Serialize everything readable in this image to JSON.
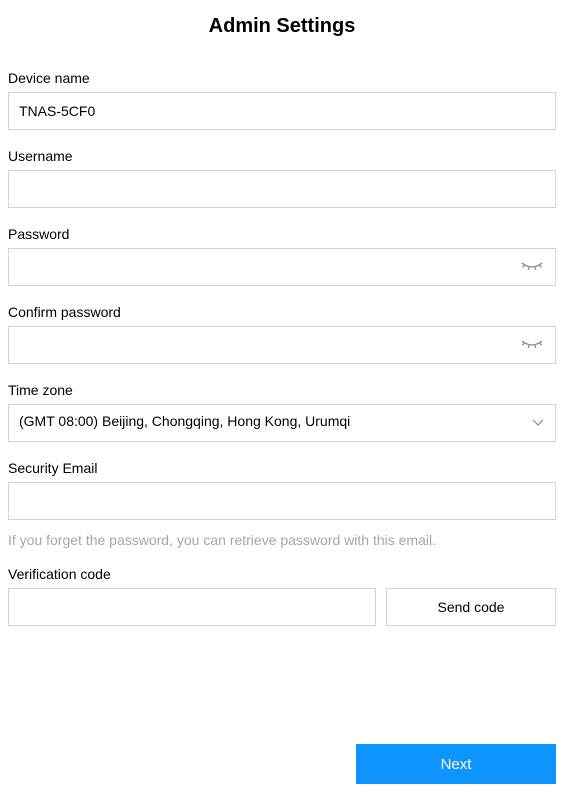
{
  "title": "Admin Settings",
  "fields": {
    "device_name": {
      "label": "Device name",
      "value": "TNAS-5CF0"
    },
    "username": {
      "label": "Username",
      "value": ""
    },
    "password": {
      "label": "Password",
      "value": ""
    },
    "confirm_password": {
      "label": "Confirm password",
      "value": ""
    },
    "timezone": {
      "label": "Time zone",
      "value": "(GMT 08:00) Beijing, Chongqing, Hong Kong, Urumqi"
    },
    "security_email": {
      "label": "Security Email",
      "value": "",
      "helper": "If you forget the password, you can retrieve password with this email."
    },
    "verification_code": {
      "label": "Verification code",
      "value": "",
      "button_label": "Send code"
    }
  },
  "buttons": {
    "next": "Next"
  }
}
